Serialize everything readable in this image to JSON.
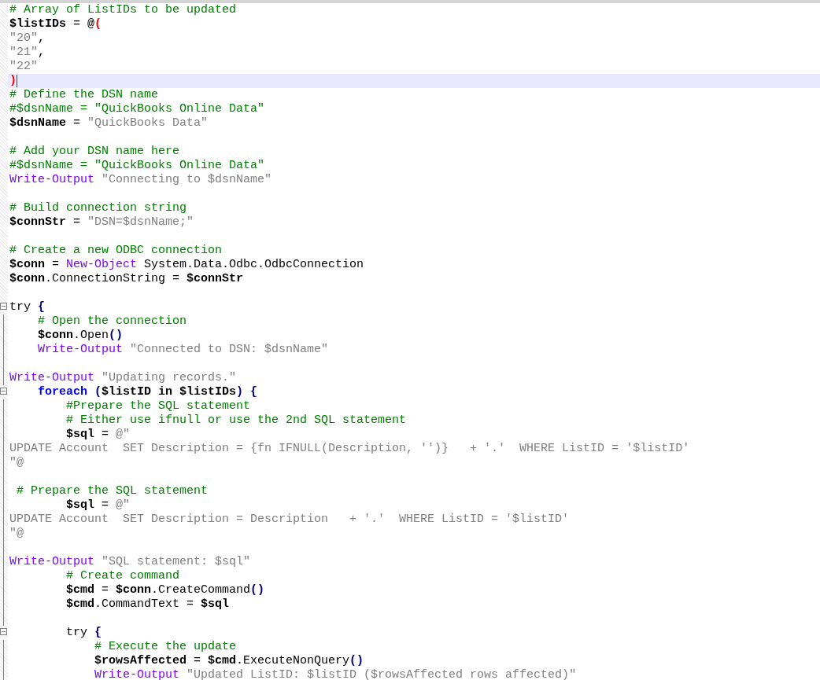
{
  "editor": {
    "lines": [
      {
        "tokens": [
          {
            "kind": "comment",
            "text": "# Array of ListIDs to be updated"
          }
        ]
      },
      {
        "tokens": [
          {
            "kind": "variable",
            "text": "$listIDs"
          },
          {
            "kind": "plain",
            "text": " = "
          },
          {
            "kind": "variable",
            "text": "@"
          },
          {
            "kind": "red",
            "text": "("
          }
        ]
      },
      {
        "tokens": [
          {
            "kind": "string",
            "text": "\"20\""
          },
          {
            "kind": "plain",
            "text": ","
          }
        ]
      },
      {
        "tokens": [
          {
            "kind": "string",
            "text": "\"21\""
          },
          {
            "kind": "plain",
            "text": ","
          }
        ]
      },
      {
        "tokens": [
          {
            "kind": "string",
            "text": "\"22\""
          }
        ]
      },
      {
        "current": true,
        "tokens": [
          {
            "kind": "red",
            "text": ")"
          }
        ]
      },
      {
        "tokens": [
          {
            "kind": "comment",
            "text": "# Define the DSN name"
          }
        ]
      },
      {
        "tokens": [
          {
            "kind": "comment",
            "text": "#$dsnName = \"QuickBooks Online Data\""
          }
        ]
      },
      {
        "tokens": [
          {
            "kind": "variable",
            "text": "$dsnName"
          },
          {
            "kind": "plain",
            "text": " = "
          },
          {
            "kind": "string",
            "text": "\"QuickBooks Data\""
          }
        ]
      },
      {
        "kind": "blank"
      },
      {
        "tokens": [
          {
            "kind": "comment",
            "text": "# Add your DSN name here"
          }
        ]
      },
      {
        "tokens": [
          {
            "kind": "comment",
            "text": "#$dsnName = \"QuickBooks Online Data\""
          }
        ]
      },
      {
        "tokens": [
          {
            "kind": "cmdlet",
            "text": "Write-Output "
          },
          {
            "kind": "string",
            "text": "\"Connecting to $dsnName\""
          }
        ]
      },
      {
        "kind": "blank"
      },
      {
        "tokens": [
          {
            "kind": "comment",
            "text": "# Build connection string"
          }
        ]
      },
      {
        "tokens": [
          {
            "kind": "variable",
            "text": "$connStr"
          },
          {
            "kind": "plain",
            "text": " = "
          },
          {
            "kind": "string",
            "text": "\"DSN=$dsnName;\""
          }
        ]
      },
      {
        "kind": "blank"
      },
      {
        "tokens": [
          {
            "kind": "comment",
            "text": "# Create a new ODBC connection"
          }
        ]
      },
      {
        "tokens": [
          {
            "kind": "variable",
            "text": "$conn"
          },
          {
            "kind": "plain",
            "text": " = "
          },
          {
            "kind": "cmdlet",
            "text": "New-Object"
          },
          {
            "kind": "plain",
            "text": " System.Data.Odbc.OdbcConnection"
          }
        ]
      },
      {
        "tokens": [
          {
            "kind": "variable",
            "text": "$conn"
          },
          {
            "kind": "plain",
            "text": ".ConnectionString = "
          },
          {
            "kind": "variable",
            "text": "$connStr"
          }
        ]
      },
      {
        "kind": "blank"
      },
      {
        "fold_marker": true,
        "tokens": [
          {
            "kind": "plain",
            "text": "try "
          },
          {
            "kind": "operator",
            "text": "{"
          }
        ]
      },
      {
        "fold_line": true,
        "tokens": [
          {
            "kind": "comment",
            "text": "    # Open the connection"
          }
        ]
      },
      {
        "fold_line": true,
        "tokens": [
          {
            "kind": "variable",
            "text": "    $conn"
          },
          {
            "kind": "plain",
            "text": ".Open"
          },
          {
            "kind": "operator",
            "text": "()"
          }
        ]
      },
      {
        "fold_line": true,
        "tokens": [
          {
            "kind": "cmdlet",
            "text": "    Write-Output "
          },
          {
            "kind": "string",
            "text": "\"Connected to DSN: $dsnName\""
          }
        ]
      },
      {
        "kind": "blank",
        "fold_line": true
      },
      {
        "fold_line": true,
        "tokens": [
          {
            "kind": "cmdlet",
            "text": "Write-Output "
          },
          {
            "kind": "string",
            "text": "\"Updating records.\""
          }
        ]
      },
      {
        "fold_marker": true,
        "tokens": [
          {
            "kind": "keyword",
            "text": "    foreach "
          },
          {
            "kind": "operator",
            "text": "("
          },
          {
            "kind": "variable",
            "text": "$listID in $listIDs"
          },
          {
            "kind": "operator",
            "text": ") {"
          }
        ]
      },
      {
        "fold_line": true,
        "tokens": [
          {
            "kind": "comment",
            "text": "        #Prepare the SQL statement"
          }
        ]
      },
      {
        "fold_line": true,
        "tokens": [
          {
            "kind": "comment",
            "text": "        # Either use ifnull or use the 2nd SQL statement"
          }
        ]
      },
      {
        "fold_line": true,
        "tokens": [
          {
            "kind": "variable",
            "text": "        $sql"
          },
          {
            "kind": "plain",
            "text": " = "
          },
          {
            "kind": "string",
            "text": "@\""
          }
        ]
      },
      {
        "fold_line": true,
        "tokens": [
          {
            "kind": "string",
            "text": "UPDATE Account  SET Description = {fn IFNULL(Description, '')}   + '.'  WHERE ListID = '$listID'"
          }
        ]
      },
      {
        "fold_line": true,
        "tokens": [
          {
            "kind": "string",
            "text": "\"@"
          }
        ]
      },
      {
        "kind": "blank",
        "fold_line": true
      },
      {
        "fold_line": true,
        "tokens": [
          {
            "kind": "comment",
            "text": " # Prepare the SQL statement"
          }
        ]
      },
      {
        "fold_line": true,
        "tokens": [
          {
            "kind": "variable",
            "text": "        $sql"
          },
          {
            "kind": "plain",
            "text": " = "
          },
          {
            "kind": "string",
            "text": "@\""
          }
        ]
      },
      {
        "fold_line": true,
        "tokens": [
          {
            "kind": "string",
            "text": "UPDATE Account  SET Description = Description   + '.'  WHERE ListID = '$listID'"
          }
        ]
      },
      {
        "fold_line": true,
        "tokens": [
          {
            "kind": "string",
            "text": "\"@"
          }
        ]
      },
      {
        "kind": "blank",
        "fold_line": true
      },
      {
        "fold_line": true,
        "tokens": [
          {
            "kind": "cmdlet",
            "text": "Write-Output "
          },
          {
            "kind": "string",
            "text": "\"SQL statement: $sql\""
          }
        ]
      },
      {
        "fold_line": true,
        "tokens": [
          {
            "kind": "comment",
            "text": "        # Create command"
          }
        ]
      },
      {
        "fold_line": true,
        "tokens": [
          {
            "kind": "variable",
            "text": "        $cmd"
          },
          {
            "kind": "plain",
            "text": " = "
          },
          {
            "kind": "variable",
            "text": "$conn"
          },
          {
            "kind": "plain",
            "text": ".CreateCommand"
          },
          {
            "kind": "operator",
            "text": "()"
          }
        ]
      },
      {
        "fold_line": true,
        "tokens": [
          {
            "kind": "variable",
            "text": "        $cmd"
          },
          {
            "kind": "plain",
            "text": ".CommandText = "
          },
          {
            "kind": "variable",
            "text": "$sql"
          }
        ]
      },
      {
        "kind": "blank",
        "fold_line": true
      },
      {
        "fold_marker": true,
        "tokens": [
          {
            "kind": "plain",
            "text": "        try "
          },
          {
            "kind": "operator",
            "text": "{"
          }
        ]
      },
      {
        "fold_line": true,
        "tokens": [
          {
            "kind": "comment",
            "text": "            # Execute the update"
          }
        ]
      },
      {
        "fold_line": true,
        "tokens": [
          {
            "kind": "variable",
            "text": "            $rowsAffected"
          },
          {
            "kind": "plain",
            "text": " = "
          },
          {
            "kind": "variable",
            "text": "$cmd"
          },
          {
            "kind": "plain",
            "text": ".ExecuteNonQuery"
          },
          {
            "kind": "operator",
            "text": "()"
          }
        ]
      },
      {
        "fold_line": true,
        "tokens": [
          {
            "kind": "cmdlet",
            "text": "            Write-Output "
          },
          {
            "kind": "string",
            "text": "\"Updated ListID: $listID ($rowsAffected rows affected)\""
          }
        ]
      }
    ]
  }
}
